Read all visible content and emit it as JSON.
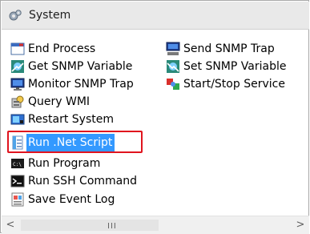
{
  "header": {
    "title": "System",
    "icon": "gear-cluster-icon"
  },
  "left_column": [
    {
      "label": "End Process",
      "icon": "window-close-icon"
    },
    {
      "label": "Get SNMP Variable",
      "icon": "snmp-get-icon"
    },
    {
      "label": "Monitor SNMP Trap",
      "icon": "monitor-trap-icon"
    },
    {
      "label": "Query WMI",
      "icon": "wmi-query-icon"
    },
    {
      "label": "Restart System",
      "icon": "restart-icon"
    },
    {
      "label": "Run .Net Script",
      "icon": "script-icon",
      "selected": true
    },
    {
      "label": "Run Program",
      "icon": "console-icon"
    },
    {
      "label": "Run SSH Command",
      "icon": "terminal-icon"
    },
    {
      "label": "Save Event Log",
      "icon": "event-log-icon"
    }
  ],
  "right_column": [
    {
      "label": "Send SNMP Trap",
      "icon": "send-trap-icon"
    },
    {
      "label": "Set SNMP Variable",
      "icon": "snmp-set-icon"
    },
    {
      "label": "Start/Stop Service",
      "icon": "service-icon"
    }
  ],
  "scrollbar": {
    "left_arrow": "<",
    "right_arrow": ">",
    "grip": "III"
  },
  "colors": {
    "selection": "#3399ff",
    "highlight_border": "#e0141e"
  }
}
